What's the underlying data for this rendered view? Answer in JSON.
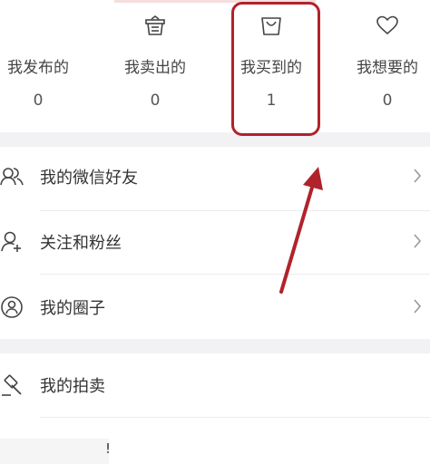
{
  "stats": [
    {
      "label": "我发布的",
      "count": "0",
      "icon": "none"
    },
    {
      "label": "我卖出的",
      "count": "0",
      "icon": "basket-icon"
    },
    {
      "label": "我买到的",
      "count": "1",
      "icon": "shopping-bag-icon"
    },
    {
      "label": "我想要的",
      "count": "0",
      "icon": "heart-icon"
    }
  ],
  "menu_group_1": [
    {
      "label": "我的微信好友",
      "icon": "friends-icon"
    },
    {
      "label": "关注和粉丝",
      "icon": "follow-icon"
    },
    {
      "label": "我的圈子",
      "icon": "circle-icon"
    }
  ],
  "menu_group_2": [
    {
      "label": "我的拍卖",
      "icon": "auction-hammer-icon"
    }
  ],
  "footer": {
    "text": "!"
  },
  "annotation": {
    "color": "#b0232b"
  }
}
